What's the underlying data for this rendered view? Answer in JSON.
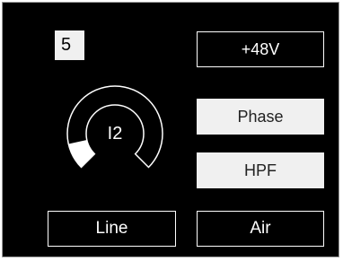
{
  "channel": {
    "number": "5"
  },
  "gain_knob": {
    "label": "I2",
    "level": 0.12
  },
  "buttons": {
    "phantom_label": "+48V",
    "phase_label": "Phase",
    "hpf_label": "HPF",
    "line_label": "Line",
    "air_label": "Air"
  },
  "colors": {
    "background": "#000000",
    "foreground": "#ffffff",
    "button_fill": "#f0f0f0",
    "panel_border": "#9a9a9a"
  }
}
